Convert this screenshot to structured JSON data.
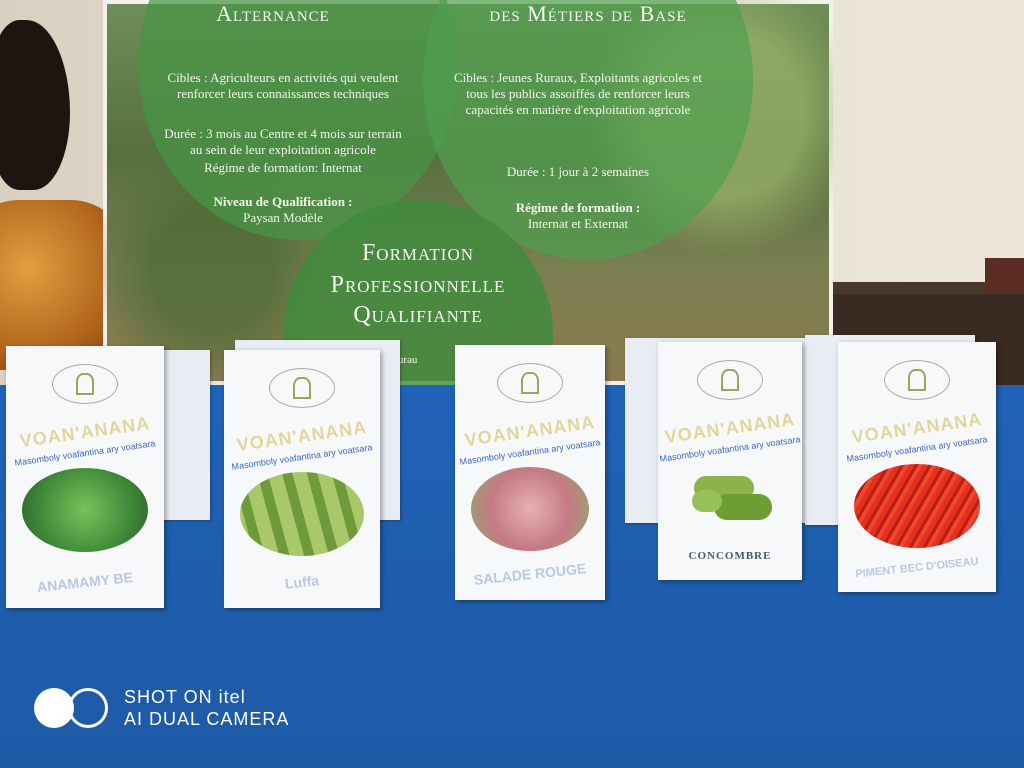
{
  "poster": {
    "left_title": "Alternance",
    "left_cibles": "Cibles : Agriculteurs en activités qui veulent renforcer leurs connaissances techniques",
    "left_duree": "Durée : 3 mois au Centre et 4 mois sur terrain au sein de leur exploitation agricole",
    "left_regime": "Régime de formation: Internat",
    "left_niveau_label": "Niveau de Qualification :",
    "left_niveau_value": "Paysan Modèle",
    "right_title": "des Métiers de Base",
    "right_cibles": "Cibles : Jeunes Ruraux, Exploitants agricoles et tous les publics assoiffés de renforcer leurs capacités en matière d'exploitation agricole",
    "right_duree": "Durée : 1 jour à 2 semaines",
    "right_regime_label": "Régime de formation :",
    "right_regime_value": "Internat et Externat",
    "center_line1": "Formation",
    "center_line2": "Professionnelle",
    "center_line3": "Qualifiante",
    "partial_text": "es Rurau"
  },
  "packets": [
    {
      "brand": "VOAN'ANANA",
      "slogan": "Masomboly voafantina ary voatsara",
      "label": "ANAMAMY BE",
      "art_color": "#3f8a3a"
    },
    {
      "brand": "VOAN'ANANA",
      "slogan": "Masomboly voafantina ary voatsara",
      "label": "Luffa",
      "art_color": "#8fb25a"
    },
    {
      "brand": "VOAN'ANANA",
      "slogan": "Masomboly voafantina ary voatsara",
      "label": "SALADE ROUGE",
      "art_color": "#c47a84"
    },
    {
      "brand": "VOAN'ANANA",
      "slogan": "Masomboly voafantina ary voatsara",
      "label": "CONCOMBRE",
      "art_color": "#7aa83e"
    },
    {
      "brand": "VOAN'ANANA",
      "slogan": "Masomboly voafantina ary voatsara",
      "label": "PIMENT BEC D'OISEAU",
      "art_color": "#d8261c"
    }
  ],
  "watermark": {
    "line1": "SHOT ON itel",
    "line2": "AI DUAL CAMERA"
  }
}
